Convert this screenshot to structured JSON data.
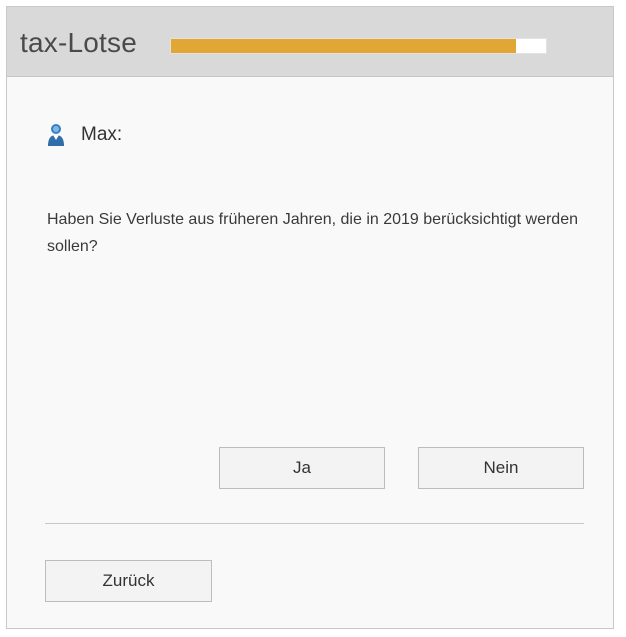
{
  "header": {
    "app_title": "tax-Lotse",
    "progress_fraction": 0.92,
    "progress_color": "#e1a735"
  },
  "conversation": {
    "speaker_icon": "person-icon",
    "speaker_name": "Max:",
    "question": "Haben Sie Verluste aus früheren Jahren, die in 2019 berücksichtigt werden sollen?"
  },
  "answers": {
    "yes_label": "Ja",
    "no_label": "Nein"
  },
  "navigation": {
    "back_label": "Zurück"
  }
}
